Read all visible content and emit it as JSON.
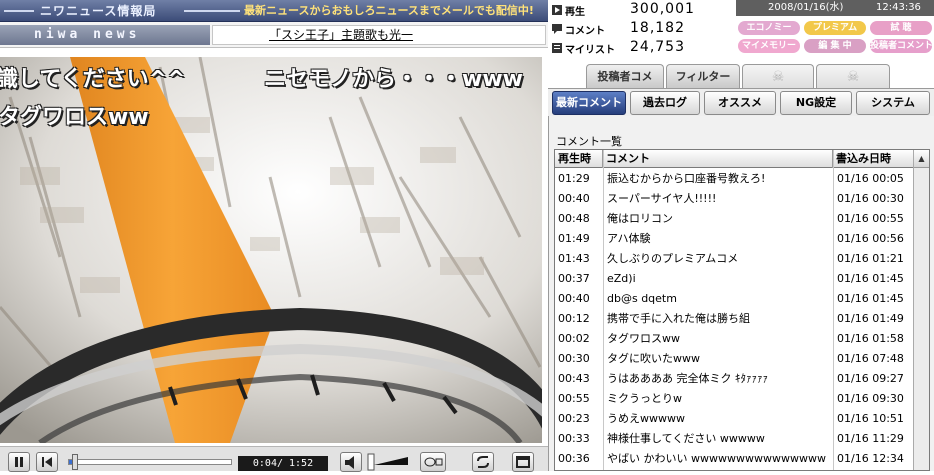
{
  "banner": {
    "title": "ニワニュース情報局",
    "text": "最新ニュースからおもしろニュースまでメールでも配信中!"
  },
  "ticker": {
    "logo": "niwa news",
    "headline": "「スシ王子」主題歌も光一"
  },
  "video": {
    "comments": [
      {
        "text": "識してください^^"
      },
      {
        "text": "ニセモノから・・・www"
      },
      {
        "text": "タグワロスww"
      }
    ]
  },
  "controls": {
    "time_display": "0:04/ 1:52",
    "seek_progress": 0.036
  },
  "stats": {
    "views_label": "再生",
    "views_value": "300,001",
    "comments_label": "コメント",
    "comments_value": "18,182",
    "mylist_label": "マイリスト",
    "mylist_value": "24,753"
  },
  "datetime": {
    "date": "2008/01/16(水)",
    "time": "12:43:36"
  },
  "mode_pills": [
    {
      "label": "エコノミー",
      "color": "#e3a9d0"
    },
    {
      "label": "プレミアム",
      "color": "#f2c84a"
    },
    {
      "label": "試 聴",
      "color": "#e8a0c7"
    },
    {
      "label": "マイメモリー",
      "color": "#f0a8cf"
    },
    {
      "label": "編 集 中",
      "color": "#d9a0c4"
    },
    {
      "label": "投稿者コメント",
      "color": "#e69fcb"
    }
  ],
  "top_tabs": [
    {
      "label": "投稿者コメ"
    },
    {
      "label": "フィルター"
    },
    {
      "label": "☠"
    },
    {
      "label": "☠"
    }
  ],
  "tabs": [
    {
      "label": "最新コメント",
      "active": true
    },
    {
      "label": "過去ログ"
    },
    {
      "label": "オススメ"
    },
    {
      "label": "NG設定"
    },
    {
      "label": "システム"
    }
  ],
  "comment_list": {
    "title": "コメント一覧",
    "headers": {
      "time": "再生時",
      "text": "コメント",
      "date": "書込み日時"
    },
    "rows": [
      {
        "time": "01:29",
        "text": "振込むからから口座番号教えろ!",
        "date": "01/16 00:05"
      },
      {
        "time": "00:40",
        "text": "スーパーサイヤ人!!!!!",
        "date": "01/16 00:30"
      },
      {
        "time": "00:48",
        "text": "俺はロリコン",
        "date": "01/16 00:55"
      },
      {
        "time": "01:49",
        "text": "アハ体験",
        "date": "01/16 00:56"
      },
      {
        "time": "01:43",
        "text": "久しぶりのプレミアムコメ",
        "date": "01/16 01:21"
      },
      {
        "time": "00:37",
        "text": "eZd)i",
        "date": "01/16 01:45"
      },
      {
        "time": "00:40",
        "text": "db@s dqetm",
        "date": "01/16 01:45"
      },
      {
        "time": "00:12",
        "text": "携帯で手に入れた俺は勝ち組",
        "date": "01/16 01:49"
      },
      {
        "time": "00:02",
        "text": "タグワロスww",
        "date": "01/16 01:58"
      },
      {
        "time": "00:30",
        "text": "タグに吹いたwww",
        "date": "01/16 07:48"
      },
      {
        "time": "00:43",
        "text": "うはああああ 完全体ミク ｷﾀｧｧｧｧ",
        "date": "01/16 09:27"
      },
      {
        "time": "00:55",
        "text": "ミクうっとりw",
        "date": "01/16 09:30"
      },
      {
        "time": "00:23",
        "text": "うめえwwwww",
        "date": "01/16 10:51"
      },
      {
        "time": "00:33",
        "text": "神様仕事してください wwwww",
        "date": "01/16 11:29"
      },
      {
        "time": "00:36",
        "text": "やばい かわいい wwwwwwwwwwwwwww",
        "date": "01/16 12:34"
      }
    ]
  }
}
